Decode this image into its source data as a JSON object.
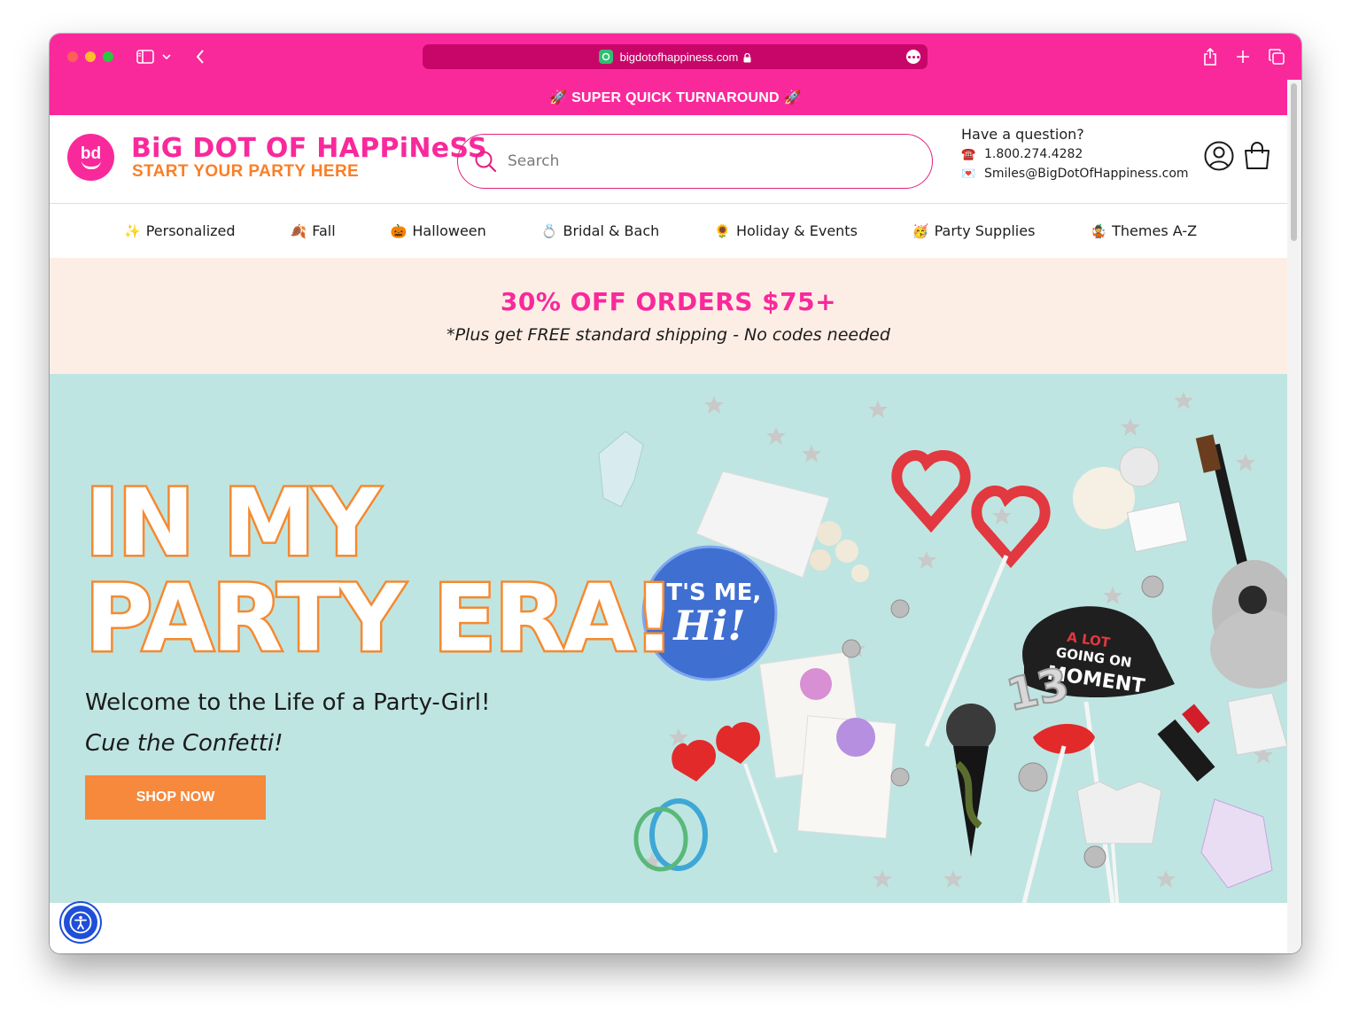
{
  "browser": {
    "url": "bigdotofhappiness.com"
  },
  "announcement": "🚀 SUPER QUICK TURNAROUND 🚀",
  "header": {
    "logo_text": "bd",
    "brand": "BiG DOT OF HAPPiNeSS",
    "tagline": "START YOUR PARTY HERE",
    "search_placeholder": "Search",
    "question": "Have a question?",
    "phone": "1.800.274.4282",
    "email": "Smiles@BigDotOfHappiness.com"
  },
  "nav": {
    "items": [
      {
        "emoji": "✨",
        "label": "Personalized"
      },
      {
        "emoji": "🍂",
        "label": "Fall"
      },
      {
        "emoji": "🎃",
        "label": "Halloween"
      },
      {
        "emoji": "💍",
        "label": "Bridal & Bach"
      },
      {
        "emoji": "🌻",
        "label": "Holiday & Events"
      },
      {
        "emoji": "🥳",
        "label": "Party Supplies"
      },
      {
        "emoji": "🤹",
        "label": "Themes A-Z"
      }
    ]
  },
  "promo": {
    "headline": "30% OFF ORDERS $75+",
    "subtext": "*Plus get FREE standard shipping - No codes needed"
  },
  "hero": {
    "title_line1": "IN MY",
    "title_line2": "PARTY ERA!",
    "subtitle": "Welcome to the Life of a Party-Girl!",
    "subtitle2": "Cue the Confetti!",
    "cta": "SHOP NOW",
    "badge_text": "IT'S ME, Hi!",
    "hat_text": "A LOT GOING ON AT THE MOMENT",
    "number_text": "13"
  },
  "colors": {
    "brand_pink": "#f9299b",
    "brand_orange": "#f97f28",
    "hero_bg": "#bfe5e2",
    "promo_bg": "#fdeee5"
  }
}
